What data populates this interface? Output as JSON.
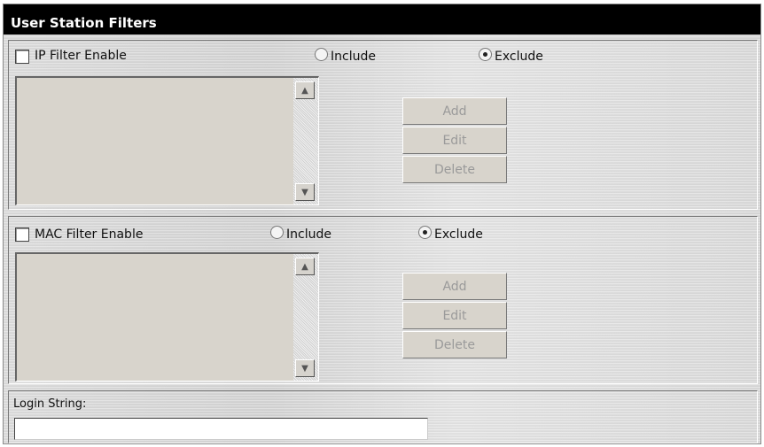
{
  "title": "User Station Filters",
  "ip_filter": {
    "enable_label": "IP Filter Enable",
    "include_label": "Include",
    "exclude_label": "Exclude",
    "selected": "Exclude",
    "buttons": {
      "add": "Add",
      "edit": "Edit",
      "delete": "Delete"
    }
  },
  "mac_filter": {
    "enable_label": "MAC Filter Enable",
    "include_label": "Include",
    "exclude_label": "Exclude",
    "selected": "Exclude",
    "buttons": {
      "add": "Add",
      "edit": "Edit",
      "delete": "Delete"
    }
  },
  "login": {
    "label": "Login String:",
    "value": ""
  },
  "icons": {
    "scroll_up": "up-arrow-icon",
    "scroll_down": "down-arrow-icon"
  }
}
